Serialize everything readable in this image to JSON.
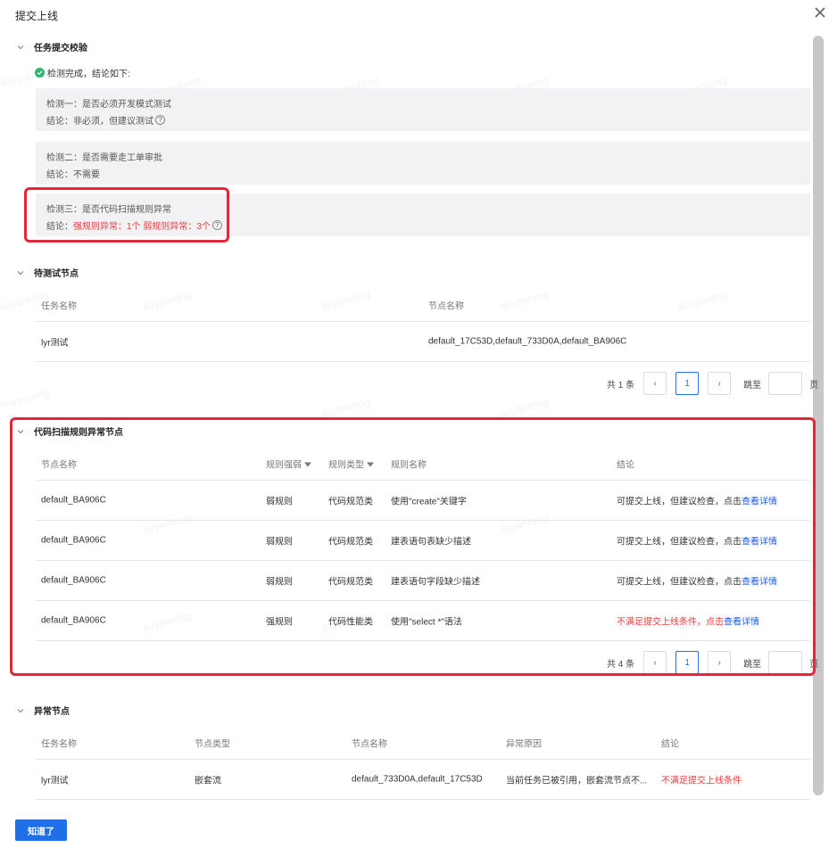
{
  "dialog": {
    "title": "提交上线",
    "close_icon": "close-icon"
  },
  "sections": {
    "task_check": {
      "title": "任务提交校验"
    },
    "pending_nodes": {
      "title": "待测试节点"
    },
    "scan_nodes": {
      "title": "代码扫描规则异常节点"
    },
    "abnormal_nodes": {
      "title": "异常节点"
    }
  },
  "check_status": "检测完成，结论如下:",
  "checks": [
    {
      "label": "检测一：是否必须开发模式测试",
      "conclusion_prefix": "结论：",
      "conclusion": "非必须，但建议测试"
    },
    {
      "label": "检测二：是否需要走工单审批",
      "conclusion_prefix": "结论：",
      "conclusion": "不需要"
    },
    {
      "label": "检测三：是否代码扫描规则异常",
      "conclusion_prefix": "结论：",
      "conclusion": "强规则异常：1个 弱规则异常：3个"
    }
  ],
  "pending_table": {
    "columns": [
      "任务名称",
      "节点名称"
    ],
    "rows": [
      {
        "task": "lyr测试",
        "nodes": "default_17C53D,default_733D0A,default_BA906C"
      }
    ]
  },
  "pager1": {
    "total": "共 1 条",
    "prev": "‹",
    "page": "1",
    "next": "›",
    "goto": "跳至",
    "page_unit": "页"
  },
  "scan_table": {
    "columns": [
      "节点名称",
      "规则强弱",
      "规则类型",
      "规则名称",
      "结论"
    ],
    "rows": [
      {
        "node": "default_BA906C",
        "strength": "弱规则",
        "type": "代码规范类",
        "rule": "使用\"create\"关键字",
        "conclusion": "可提交上线，但建议检查，点击",
        "link": "查看详情"
      },
      {
        "node": "default_BA906C",
        "strength": "弱规则",
        "type": "代码规范类",
        "rule": "建表语句表缺少描述",
        "conclusion": "可提交上线，但建议检查，点击",
        "link": "查看详情"
      },
      {
        "node": "default_BA906C",
        "strength": "弱规则",
        "type": "代码规范类",
        "rule": "建表语句字段缺少描述",
        "conclusion": "可提交上线，但建议检查，点击",
        "link": "查看详情"
      },
      {
        "node": "default_BA906C",
        "strength": "强规则",
        "type": "代码性能类",
        "rule": "使用\"select *\"语法",
        "conclusion": "不满足提交上线条件，点击",
        "link": "查看详情"
      }
    ]
  },
  "pager2": {
    "total": "共 4 条",
    "prev": "‹",
    "page": "1",
    "next": "›",
    "goto": "跳至",
    "page_unit": "页"
  },
  "abnormal_table": {
    "columns": [
      "任务名称",
      "节点类型",
      "节点名称",
      "异常原因",
      "结论"
    ],
    "rows": [
      {
        "task": "lyr测试",
        "node_type": "嵌套流",
        "nodes": "default_733D0A,default_17C53D",
        "reason": "当前任务已被引用，嵌套流节点不...",
        "conclusion": "不满足提交上线条件"
      }
    ]
  },
  "ack_button": "知道了",
  "watermark": "liuyanrong",
  "colors": {
    "primary": "#1e6fe8",
    "error": "#e23b3b",
    "success": "#2bb673",
    "highlight_border": "#e3263a"
  }
}
